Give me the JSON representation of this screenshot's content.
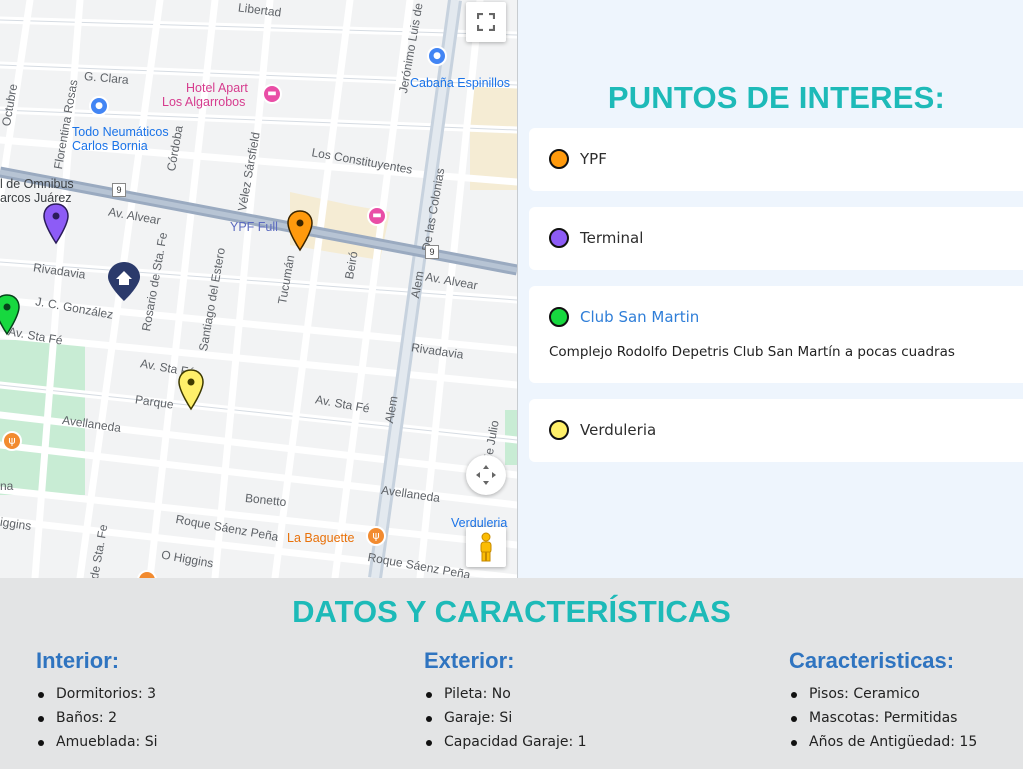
{
  "map": {
    "streets": {
      "libertad": "Libertad",
      "g_clara": "G. Clara",
      "los_constituyentes": "Los Constituyentes",
      "av_alvear_left": "Av. Alvear",
      "av_alvear_right": "Av. Alvear",
      "rivadavia_left": "Rivadavia",
      "rivadavia_right": "Rivadavia",
      "jc_gonzalez": "J. C. González",
      "av_sta_fe_left": "Av. Sta Fé",
      "av_sta_fe_mid": "Av. Sta Fé",
      "av_sta_fe_right": "Av. Sta Fé",
      "parque": "Parque",
      "avellaneda_left": "Avellaneda",
      "avellaneda_right": "Avellaneda",
      "bonetto": "Bonetto",
      "roque_saenz_pena_1": "Roque Sáenz Peña",
      "roque_saenz_pena_2": "Roque Sáenz Peña",
      "o_higgins": "O Higgins",
      "cordoba": "Córdoba",
      "velez_sarsfield": "Vélez Sársfield",
      "rosario_de_sta_fe": "Rosario de Sta. Fe",
      "santiago_del_estero": "Santiago del Estero",
      "tucuman": "Tucumán",
      "beiro": "Beiró",
      "alem_1": "Alem",
      "alem_2": "Alem",
      "de_las_colonias": "De las Colonias",
      "jeronimo_luis": "Jerónimo Luis de",
      "florentina_rosas": "Florentina Rosas",
      "octubre": "Octubre",
      "nueve_julio": "9 de Julio",
      "de_sta_fe": "de Sta. Fe",
      "higgins_left": "iggins",
      "na_left": "na"
    },
    "route_badge": "9",
    "places": {
      "hotel_line1": "Hotel Apart",
      "hotel_line2": "Los Algarrobos",
      "neumaticos_line1": "Todo Neumáticos",
      "neumaticos_line2": "Carlos Bornia",
      "cabana": "Cabaña Espinillos",
      "terminal_line1": "l de Omnibus",
      "terminal_line2": "arcos Juárez",
      "ypf_full": "YPF Full",
      "la_baguette": "La Baguette",
      "verduleria": "Verduleria"
    },
    "icons": {
      "fullscreen": "fullscreen-icon",
      "pan": "pan-control-icon",
      "pegman": "street-view-pegman-icon"
    }
  },
  "poi": {
    "title": "PUNTOS DE INTERES:",
    "items": [
      {
        "name": "YPF",
        "color": "#ff9a0d",
        "active": false,
        "description": ""
      },
      {
        "name": "Terminal",
        "color": "#8d5cf6",
        "active": false,
        "description": ""
      },
      {
        "name": "Club San Martin",
        "color": "#17d83f",
        "active": true,
        "description": "Complejo Rodolfo Depetris Club San Martín a pocas cuadras"
      },
      {
        "name": "Verduleria",
        "color": "#fff06a",
        "active": false,
        "description": ""
      }
    ]
  },
  "features": {
    "title": "DATOS Y CARACTERÍSTICAS",
    "interior": {
      "heading": "Interior:",
      "items": [
        "Dormitorios: 3",
        "Baños: 2",
        "Amueblada: Si"
      ]
    },
    "exterior": {
      "heading": "Exterior:",
      "items": [
        "Pileta: No",
        "Garaje: Si",
        "Capacidad Garaje: 1"
      ]
    },
    "caracteristicas": {
      "heading": "Caracteristicas:",
      "items": [
        "Pisos: Ceramico",
        "Mascotas: Permitidas",
        "Años de Antigüedad: 15"
      ]
    }
  },
  "colors": {
    "accent_teal": "#1dbab8",
    "heading_blue": "#2f74c0",
    "marker_orange": "#ff9a0d",
    "marker_purple": "#8d5cf6",
    "marker_green": "#17d83f",
    "marker_yellow": "#fff06a",
    "home_marker": "#2b3a6b"
  }
}
